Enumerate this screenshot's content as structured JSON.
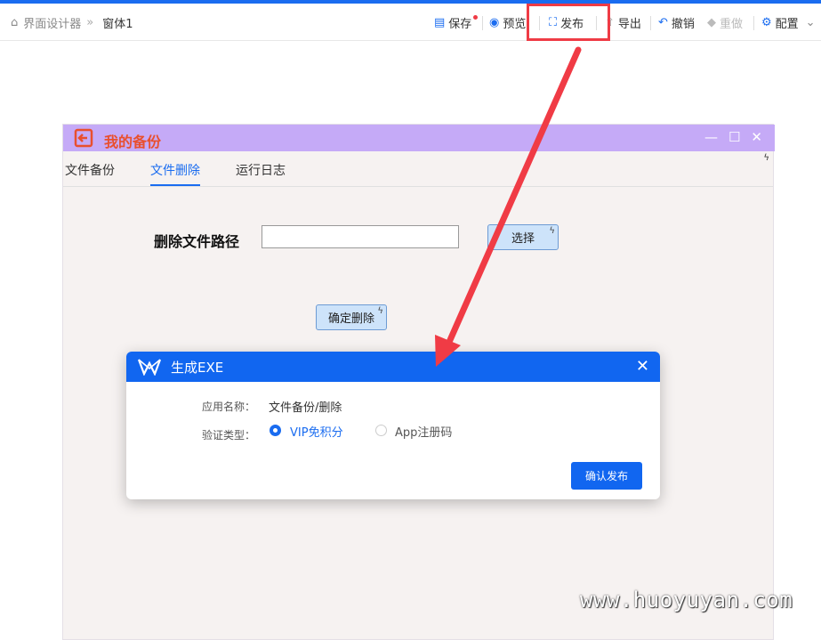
{
  "breadcrumb": {
    "root": "界面设计器",
    "current": "窗体1"
  },
  "toolbar": {
    "save": "保存",
    "preview": "预览",
    "publish": "发布",
    "export": "导出",
    "undo": "撤销",
    "redo": "重做",
    "config": "配置"
  },
  "form_window": {
    "title": "我的备份",
    "tabs": [
      "文件备份",
      "文件删除",
      "运行日志"
    ],
    "active_tab": "文件删除",
    "path_label": "删除文件路径",
    "path_value": "",
    "select_button": "选择",
    "confirm_delete_button": "确定删除"
  },
  "dialog": {
    "title": "生成EXE",
    "app_name_label": "应用名称：",
    "app_name_value": "文件备份/删除",
    "auth_label": "验证类型：",
    "options": [
      "VIP免积分",
      "App注册码"
    ],
    "selected_option": "VIP免积分",
    "confirm_button": "确认发布"
  },
  "watermark": "www.huoyuyan.com",
  "colors": {
    "accent": "#1166f0",
    "highlight": "#ef3b45",
    "title_bar": "#c5aaf7",
    "title_text": "#e94f2e"
  }
}
